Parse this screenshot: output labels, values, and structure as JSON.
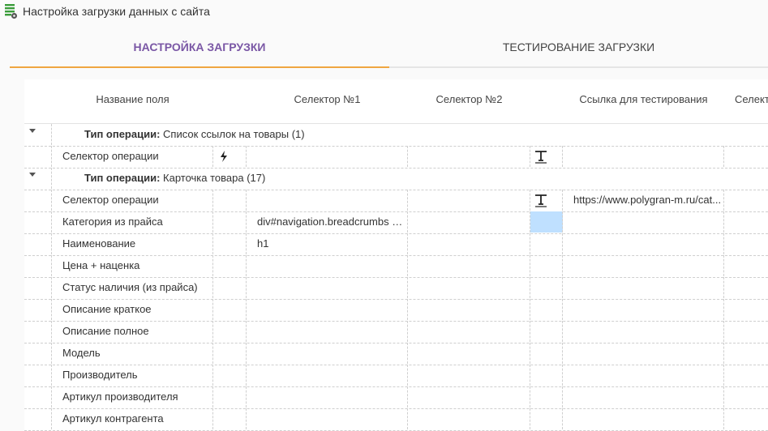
{
  "window": {
    "title": "Настройка загрузки данных с сайта",
    "icon": "settings-list-icon"
  },
  "tabs": [
    {
      "label": "НАСТРОЙКА ЗАГРУЗКИ",
      "active": true
    },
    {
      "label": "ТЕСТИРОВАНИЕ ЗАГРУЗКИ",
      "active": false
    }
  ],
  "grid": {
    "columns": [
      "Название поля",
      "Селектор №1",
      "Селектор №2",
      "Ссылка для тестирования",
      "Селект"
    ],
    "groups": [
      {
        "label_bold": "Тип операции:",
        "label_rest": " Список ссылок на товары (1)",
        "rows": [
          {
            "name": "Селектор операции",
            "selector1": "",
            "selector2": "",
            "link": "",
            "icon_left": "lightning-icon",
            "icon_right": "text-type-icon"
          }
        ]
      },
      {
        "label_bold": "Тип операции:",
        "label_rest": " Карточка товара (17)",
        "rows": [
          {
            "name": "Селектор операции",
            "selector1": "",
            "selector2": "",
            "link": "https://www.polygran-m.ru/cat...",
            "icon_right": "text-type-icon"
          },
          {
            "name": "Категория из прайса",
            "selector1": "div#navigation.breadcrumbs a ...",
            "selector2": "",
            "link": ""
          },
          {
            "name": "Наименование",
            "selector1": "h1",
            "selector2": "",
            "link": ""
          },
          {
            "name": "Цена + наценка",
            "selector1": "",
            "selector2": "",
            "link": ""
          },
          {
            "name": "Статус наличия (из прайса)",
            "selector1": "",
            "selector2": "",
            "link": ""
          },
          {
            "name": "Описание краткое",
            "selector1": "",
            "selector2": "",
            "link": ""
          },
          {
            "name": "Описание полное",
            "selector1": "",
            "selector2": "",
            "link": ""
          },
          {
            "name": "Модель",
            "selector1": "",
            "selector2": "",
            "link": ""
          },
          {
            "name": "Производитель",
            "selector1": "",
            "selector2": "",
            "link": ""
          },
          {
            "name": "Артикул производителя",
            "selector1": "",
            "selector2": "",
            "link": ""
          },
          {
            "name": "Артикул контрагента",
            "selector1": "",
            "selector2": "",
            "link": ""
          }
        ]
      }
    ]
  },
  "colors": {
    "active_tab_text": "#7a57a5",
    "active_tab_underline": "#f0a640",
    "selected_cell": "#bfe0ff"
  }
}
